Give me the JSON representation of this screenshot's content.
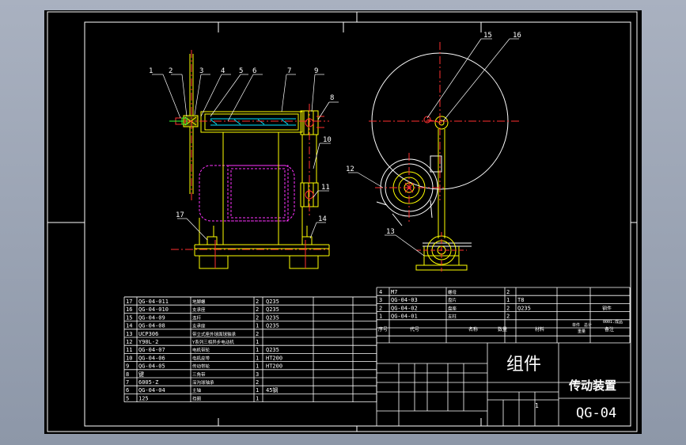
{
  "colors": {
    "background": "#000000",
    "frame": "#ffffff",
    "yellow": "#ffff00",
    "red": "#ff3030",
    "cyan": "#00e5ff",
    "magenta": "#ff33ff",
    "green": "#33ff33",
    "outer_bg": "#9fa8b8"
  },
  "balloons": [
    "1",
    "2",
    "3",
    "4",
    "5",
    "6",
    "7",
    "9",
    "8",
    "10",
    "11",
    "14",
    "17",
    "15",
    "16",
    "12",
    "13"
  ],
  "bom_left": [
    {
      "no": "17",
      "code": "QG-04-011",
      "name": "地脚螺",
      "qty": "2",
      "mat": "Q235"
    },
    {
      "no": "16",
      "code": "QG-04-010",
      "name": "支承座",
      "qty": "2",
      "mat": "Q235"
    },
    {
      "no": "15",
      "code": "QG-04-09",
      "name": "连杆",
      "qty": "2",
      "mat": "Q235"
    },
    {
      "no": "14",
      "code": "QG-04-08",
      "name": "支承座",
      "qty": "1",
      "mat": "Q235"
    },
    {
      "no": "13",
      "code": "UCP306",
      "name": "带立式座外球面球轴承",
      "qty": "2",
      "mat": ""
    },
    {
      "no": "12",
      "code": "Y90L-2",
      "name": "Y系列三相异步电动机",
      "qty": "1",
      "mat": ""
    },
    {
      "no": "11",
      "code": "QG-04-07",
      "name": "电机带轮",
      "qty": "1",
      "mat": "Q235"
    },
    {
      "no": "10",
      "code": "QG-04-06",
      "name": "电机皮带",
      "qty": "1",
      "mat": "HT200"
    },
    {
      "no": "9",
      "code": "QG-04-05",
      "name": "传动带轮",
      "qty": "1",
      "mat": "HT200"
    },
    {
      "no": "8",
      "code": "键",
      "name": "三角带",
      "qty": "3",
      "mat": ""
    },
    {
      "no": "7",
      "code": "6005-Z",
      "name": "深沟球轴承",
      "qty": "2",
      "mat": ""
    },
    {
      "no": "6",
      "code": "QG-04-04",
      "name": "主轴",
      "qty": "1",
      "mat": "45钢"
    },
    {
      "no": "5",
      "code": "125",
      "name": "挡圈",
      "qty": "1",
      "mat": ""
    }
  ],
  "bom_right": [
    {
      "no": "4",
      "code": "M7",
      "name": "螺母",
      "qty": "2",
      "mat": ""
    },
    {
      "no": "3",
      "code": "QG-04-03",
      "name": "盘片",
      "qty": "1",
      "mat": "T8"
    },
    {
      "no": "2",
      "code": "QG-04-02",
      "name": "盘座",
      "qty": "2",
      "mat": "Q235"
    },
    {
      "no": "1",
      "code": "QG-04-01",
      "name": "支柱",
      "qty": "2",
      "mat": ""
    }
  ],
  "bom_right_note": "钢件",
  "bom_right_note2": "0001.成品",
  "bom_header": {
    "no": "序号",
    "code": "代号",
    "name": "名称",
    "qty": "数量",
    "mat": "材料",
    "unit": "单件",
    "total": "总计",
    "weight": "重量",
    "remark": "备注"
  },
  "title_block": {
    "assembly": "组件",
    "name": "传动装置",
    "drawing_no": "QG-04",
    "sheet": "1"
  }
}
